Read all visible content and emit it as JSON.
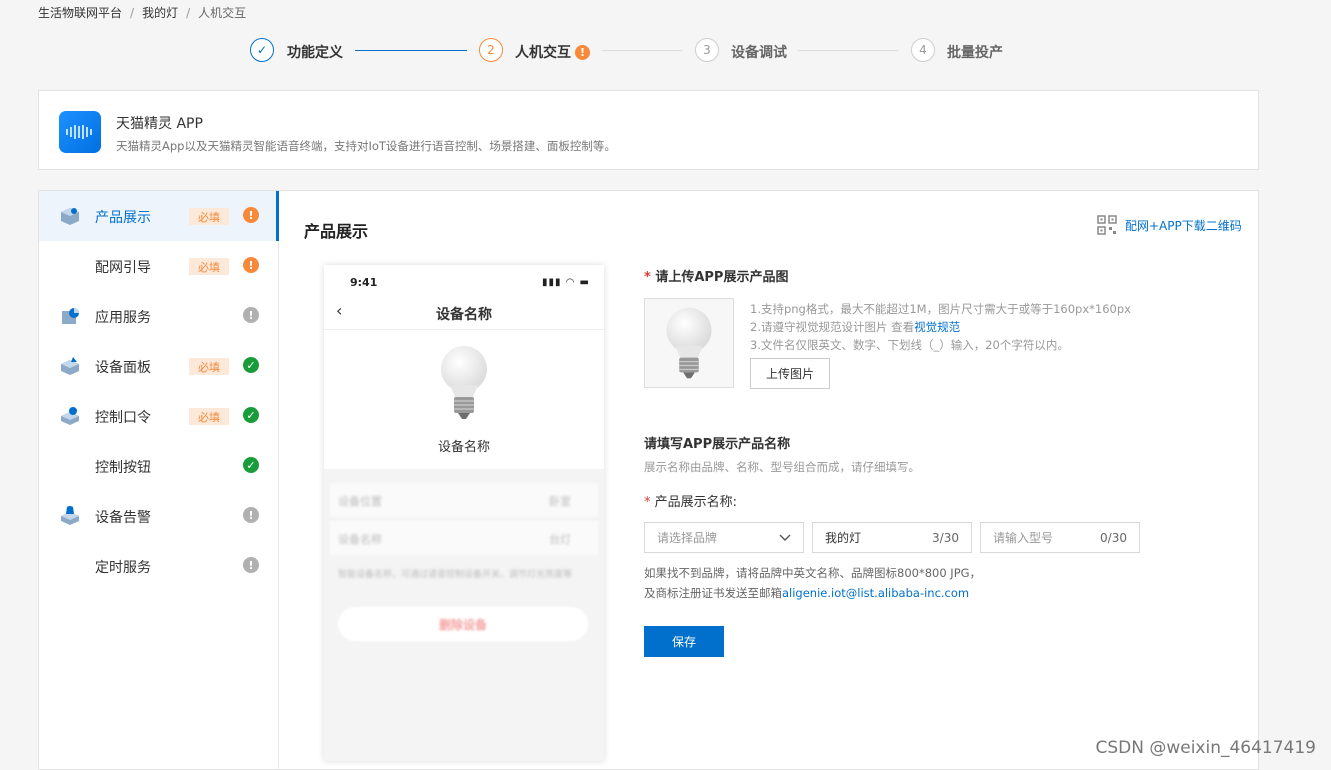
{
  "breadcrumb": {
    "items": [
      "生活物联网平台",
      "我的灯",
      "人机交互"
    ],
    "sep": "/"
  },
  "steps": [
    {
      "num": "✓",
      "label": "功能定义"
    },
    {
      "num": "2",
      "label": "人机交互",
      "badge": "!"
    },
    {
      "num": "3",
      "label": "设备调试"
    },
    {
      "num": "4",
      "label": "批量投产"
    }
  ],
  "app": {
    "title": "天猫精灵 APP",
    "desc": "天猫精灵App以及天猫精灵智能语音终端，支持对IoT设备进行语音控制、场景搭建、面板控制等。"
  },
  "sidebar": {
    "items": [
      {
        "label": "产品展示",
        "required": "必填",
        "status": "!",
        "icon": "product-display-icon"
      },
      {
        "label": "配网引导",
        "required": "必填",
        "status": "!",
        "icon": ""
      },
      {
        "label": "应用服务",
        "required": "",
        "status": "!",
        "icon": "app-service-icon"
      },
      {
        "label": "设备面板",
        "required": "必填",
        "status": "✓",
        "icon": "device-panel-icon"
      },
      {
        "label": "控制口令",
        "required": "必填",
        "status": "✓",
        "icon": "voice-command-icon"
      },
      {
        "label": "控制按钮",
        "required": "",
        "status": "✓",
        "icon": ""
      },
      {
        "label": "设备告警",
        "required": "",
        "status": "!",
        "icon": "device-alarm-icon"
      },
      {
        "label": "定时服务",
        "required": "",
        "status": "!",
        "icon": ""
      }
    ]
  },
  "content": {
    "title": "产品展示",
    "qr_link": "配网+APP下载二维码"
  },
  "phone": {
    "time": "9:41",
    "signal": "▮▮▮ ◠ ▬",
    "back": "‹",
    "title": "设备名称",
    "device_name": "设备名称",
    "blur_rows": [
      {
        "label": "设备位置",
        "value": "卧室"
      },
      {
        "label": "设备名称",
        "value": "台灯"
      }
    ],
    "blur_note": "智能设备名称，可通过语音控制设备开关，调节灯光亮度等",
    "blur_button": "删除设备"
  },
  "upload": {
    "star": "*",
    "label": "请上传APP展示产品图",
    "hint1": "1.支持png格式，最大不能超过1M，图片尺寸需大于或等于160px*160px",
    "hint2_prefix": "2.请遵守视觉规范设计图片 查看",
    "hint2_link": "视觉规范",
    "hint3": "3.文件名仅限英文、数字、下划线（_）输入，20个字符以内。",
    "button": "上传图片"
  },
  "name_form": {
    "title": "请填写APP展示产品名称",
    "desc": "展示名称由品牌、名称、型号组合而成，请仔细填写。",
    "star": "*",
    "field_label": "产品展示名称:",
    "brand_placeholder": "请选择品牌",
    "name_value": "我的灯",
    "name_count": "3/30",
    "model_placeholder": "请输入型号",
    "model_count": "0/30",
    "note1": "如果找不到品牌，请将品牌中英文名称、品牌图标800*800 JPG，",
    "note2_prefix": "及商标注册证书发送至邮箱",
    "note2_email": "aligenie.iot@list.alibaba-inc.com",
    "save": "保存"
  },
  "watermark": "CSDN @weixin_46417419",
  "colors": {
    "primary": "#0070cc",
    "warn": "#f7893a",
    "ok": "#1a9c3a",
    "required_bg": "#fde9d9"
  }
}
